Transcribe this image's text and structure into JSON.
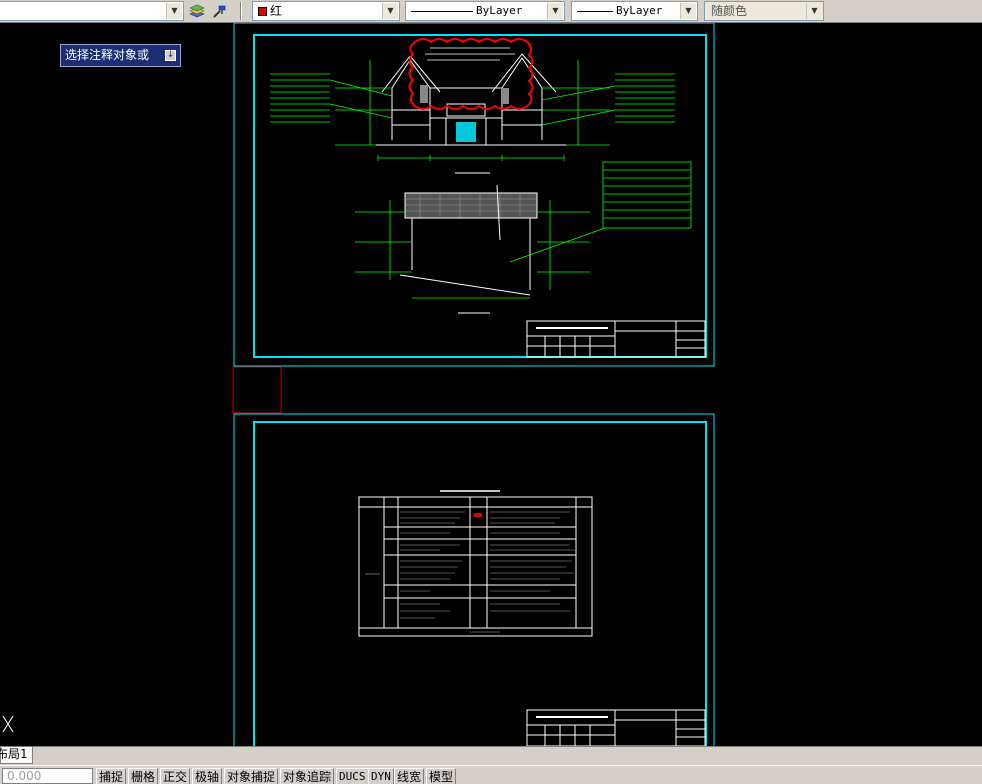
{
  "toolbar": {
    "color": {
      "value": "红",
      "swatch_color": "#e00000"
    },
    "linetype": {
      "value": "ByLayer"
    },
    "lineweight": {
      "value": "ByLayer"
    },
    "plotstyle": {
      "value": "随颜色"
    },
    "icons": [
      "layer-states-icon",
      "match-properties-icon"
    ]
  },
  "prompt": {
    "text": "选择注释对象或"
  },
  "layout_tabs": {
    "tab1": "布局1"
  },
  "status": {
    "coordinates": "0.000",
    "buttons": [
      "捕捉",
      "栅格",
      "正交",
      "极轴",
      "对象捕捉",
      "对象追踪",
      "DUCS",
      "DYN",
      "线宽",
      "模型"
    ]
  },
  "colors": {
    "sheet_border": "#00e5ee",
    "drawing_lines": "#ffffff",
    "annotation_lines": "#00ff00",
    "revision_cloud": "#ff0000",
    "viewport_box": "#c00000"
  }
}
